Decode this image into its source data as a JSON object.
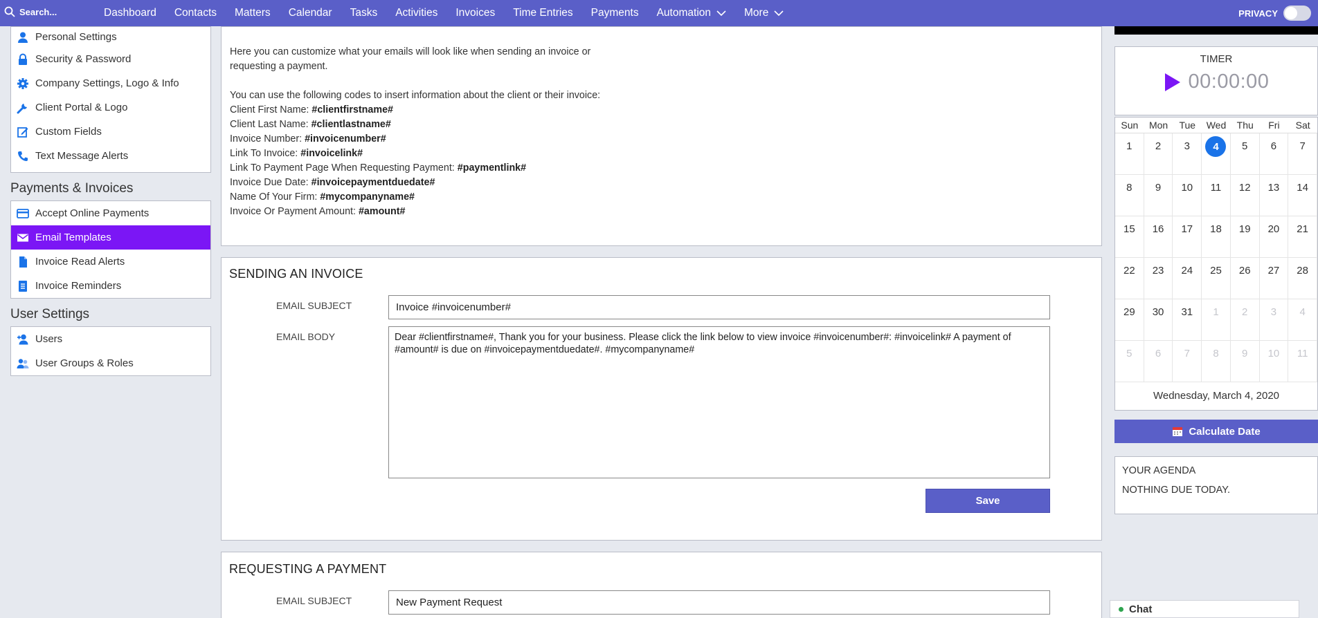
{
  "topnav": {
    "search_label": "Search...",
    "links": [
      "Dashboard",
      "Contacts",
      "Matters",
      "Calendar",
      "Tasks",
      "Activities",
      "Invoices",
      "Time Entries",
      "Payments"
    ],
    "automation_label": "Automation",
    "more_label": "More",
    "privacy_label": "PRIVACY"
  },
  "sidebar": {
    "settings_items": [
      {
        "label": "Personal Settings",
        "icon": "person-icon"
      },
      {
        "label": "Security & Password",
        "icon": "lock-icon"
      },
      {
        "label": "Company Settings, Logo & Info",
        "icon": "gear-icon"
      },
      {
        "label": "Client Portal & Logo",
        "icon": "wrench-icon"
      },
      {
        "label": "Custom Fields",
        "icon": "edit-icon"
      },
      {
        "label": "Text Message Alerts",
        "icon": "phone-icon"
      }
    ],
    "payments_title": "Payments & Invoices",
    "payments_items": [
      {
        "label": "Accept Online Payments",
        "icon": "credit-card-icon"
      },
      {
        "label": "Email Templates",
        "icon": "envelope-icon"
      },
      {
        "label": "Invoice Read Alerts",
        "icon": "file-icon"
      },
      {
        "label": "Invoice Reminders",
        "icon": "list-document-icon"
      }
    ],
    "user_title": "User Settings",
    "user_items": [
      {
        "label": "Users",
        "icon": "add-user-icon"
      },
      {
        "label": "User Groups & Roles",
        "icon": "user-group-icon"
      }
    ]
  },
  "intro": {
    "line1": "Here you can customize what your emails will look like when sending an invoice or requesting a payment.",
    "line2": "You can use the following codes to insert information about the client or their invoice:",
    "codes": [
      {
        "label": "Client First Name: ",
        "code": "#clientfirstname#"
      },
      {
        "label": "Client Last Name: ",
        "code": "#clientlastname#"
      },
      {
        "label": "Invoice Number: ",
        "code": "#invoicenumber#"
      },
      {
        "label": "Link To Invoice: ",
        "code": "#invoicelink#"
      },
      {
        "label": "Link To Payment Page When Requesting Payment: ",
        "code": "#paymentlink#"
      },
      {
        "label": "Invoice Due Date: ",
        "code": "#invoicepaymentduedate#"
      },
      {
        "label": "Name Of Your Firm: ",
        "code": "#mycompanyname#"
      },
      {
        "label": "Invoice Or Payment Amount: ",
        "code": "#amount#"
      }
    ]
  },
  "sending": {
    "title": "SENDING AN INVOICE",
    "subject_label": "EMAIL SUBJECT",
    "subject_value": "Invoice #invoicenumber#",
    "body_label": "EMAIL BODY",
    "body_value": "Dear #clientfirstname#,  Thank you for your business.  Please click the link below to view invoice #invoicenumber#:   #invoicelink#  A payment of #amount# is due on #invoicepaymentduedate#.   #mycompanyname#",
    "save_label": "Save"
  },
  "requesting": {
    "title": "REQUESTING A PAYMENT",
    "subject_label": "EMAIL SUBJECT",
    "subject_value": "New Payment Request"
  },
  "timer": {
    "label": "TIMER",
    "value": "00:00:00"
  },
  "calendar": {
    "weekdays": [
      "Sun",
      "Mon",
      "Tue",
      "Wed",
      "Thu",
      "Fri",
      "Sat"
    ],
    "weeks": [
      [
        "1",
        "2",
        "3",
        "4",
        "5",
        "6",
        "7"
      ],
      [
        "8",
        "9",
        "10",
        "11",
        "12",
        "13",
        "14"
      ],
      [
        "15",
        "16",
        "17",
        "18",
        "19",
        "20",
        "21"
      ],
      [
        "22",
        "23",
        "24",
        "25",
        "26",
        "27",
        "28"
      ],
      [
        "29",
        "30",
        "31",
        "1",
        "2",
        "3",
        "4"
      ],
      [
        "5",
        "6",
        "7",
        "8",
        "9",
        "10",
        "11"
      ]
    ],
    "today_day": "4",
    "selected_date": "Wednesday, March 4, 2020"
  },
  "calc_button_label": "Calculate Date",
  "agenda": {
    "title": "YOUR AGENDA",
    "status": "NOTHING DUE TODAY."
  },
  "chat_label": "Chat",
  "colors": {
    "nav_bg": "#5a5fc8",
    "active_item": "#7b16f5",
    "icon_blue": "#1a73e8",
    "today_circle": "#1a73e8",
    "play_purple": "#7b16f5"
  }
}
